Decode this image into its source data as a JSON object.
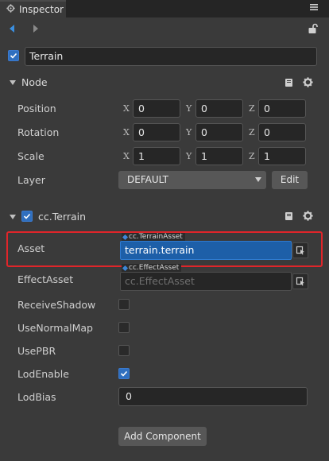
{
  "tab": {
    "title": "Inspector",
    "icon": "settings-icon"
  },
  "node": {
    "enabled": true,
    "name": "Terrain"
  },
  "node_section": {
    "title": "Node",
    "rows": [
      {
        "label": "Position",
        "x": "0",
        "y": "0",
        "z": "0"
      },
      {
        "label": "Rotation",
        "x": "0",
        "y": "0",
        "z": "0"
      },
      {
        "label": "Scale",
        "x": "1",
        "y": "1",
        "z": "1"
      }
    ],
    "axis_labels": {
      "x": "X",
      "y": "Y",
      "z": "Z"
    },
    "layer": {
      "label": "Layer",
      "value": "DEFAULT",
      "edit_label": "Edit"
    }
  },
  "terrain_section": {
    "title": "cc.Terrain",
    "enabled": true,
    "asset": {
      "label": "Asset",
      "type": "cc.TerrainAsset",
      "value": "terrain.terrain"
    },
    "effect_asset": {
      "label": "EffectAsset",
      "type": "cc.EffectAsset",
      "placeholder": "cc.EffectAsset"
    },
    "receive_shadow": {
      "label": "ReceiveShadow",
      "checked": false
    },
    "use_normal_map": {
      "label": "UseNormalMap",
      "checked": false
    },
    "use_pbr": {
      "label": "UsePBR",
      "checked": false
    },
    "lod_enable": {
      "label": "LodEnable",
      "checked": true
    },
    "lod_bias": {
      "label": "LodBias",
      "value": "0"
    }
  },
  "add_component_label": "Add Component",
  "colors": {
    "highlight": "#e0252a",
    "accent": "#2f6fbf",
    "selection": "#1d5fa8"
  }
}
